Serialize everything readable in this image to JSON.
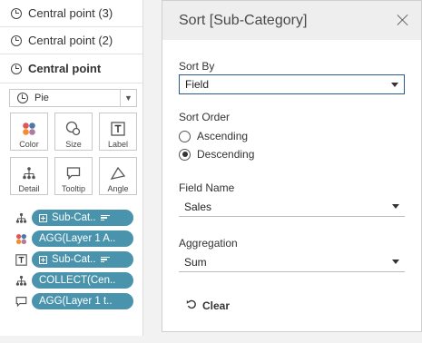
{
  "layers": [
    {
      "label": "Central point (3)",
      "active": false
    },
    {
      "label": "Central point (2)",
      "active": false
    },
    {
      "label": "Central point",
      "active": true
    }
  ],
  "marks": {
    "type_label": "Pie",
    "cards": {
      "color": "Color",
      "size": "Size",
      "label": "Label",
      "detail": "Detail",
      "tooltip": "Tooltip",
      "angle": "Angle"
    },
    "pills": [
      {
        "type_icon": "detail-icon",
        "text": "Sub-Cat..",
        "has_plus": true,
        "has_sort": true
      },
      {
        "type_icon": "color-icon",
        "text": "AGG(Layer 1 A..",
        "has_plus": false,
        "has_sort": false
      },
      {
        "type_icon": "label-icon",
        "text": "Sub-Cat..",
        "has_plus": true,
        "has_sort": true
      },
      {
        "type_icon": "detail-icon",
        "text": "COLLECT(Cen..",
        "has_plus": false,
        "has_sort": false
      },
      {
        "type_icon": "tooltip-icon",
        "text": "AGG(Layer 1 t..",
        "has_plus": false,
        "has_sort": false
      }
    ]
  },
  "dialog": {
    "title": "Sort [Sub-Category]",
    "sort_by_label": "Sort By",
    "sort_by_value": "Field",
    "sort_order_label": "Sort Order",
    "ascending_label": "Ascending",
    "descending_label": "Descending",
    "selected_order": "Descending",
    "field_name_label": "Field Name",
    "field_name_value": "Sales",
    "aggregation_label": "Aggregation",
    "aggregation_value": "Sum",
    "clear_label": "Clear"
  },
  "colors": {
    "pill": "#4a93ad",
    "focus_border": "#2a5a8c",
    "color_dots": [
      "#e15759",
      "#4e79a7",
      "#f28e2b",
      "#b07aa1"
    ]
  }
}
